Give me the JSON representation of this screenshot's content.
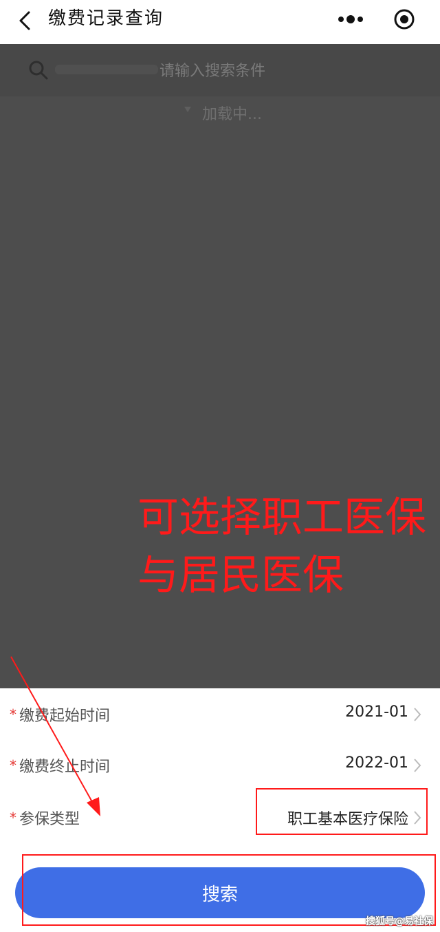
{
  "titlebar": {
    "title": "缴费记录查询",
    "back_icon": "chevron-left-icon",
    "more_icon": "more-dots-icon",
    "target_icon": "target-icon"
  },
  "overlay": {
    "search_placeholder": "请输入搜索条件",
    "loading_text": "加载中...",
    "annotation": "可选择职工医保\n与居民医保"
  },
  "form": {
    "rows": [
      {
        "required_mark": "*",
        "label": "缴费起始时间",
        "value": "2021-01"
      },
      {
        "required_mark": "*",
        "label": "缴费终止时间",
        "value": "2022-01"
      },
      {
        "required_mark": "*",
        "label": "参保类型",
        "value": "职工基本医疗保险"
      }
    ],
    "search_button_label": "搜索"
  },
  "colors": {
    "annotation_red": "#ff1a1a",
    "button_blue": "#3f6ee6",
    "overlay_gray": "#4d4d4d",
    "asterisk_red": "#e53935"
  },
  "watermark": "搜狐号@易社保"
}
